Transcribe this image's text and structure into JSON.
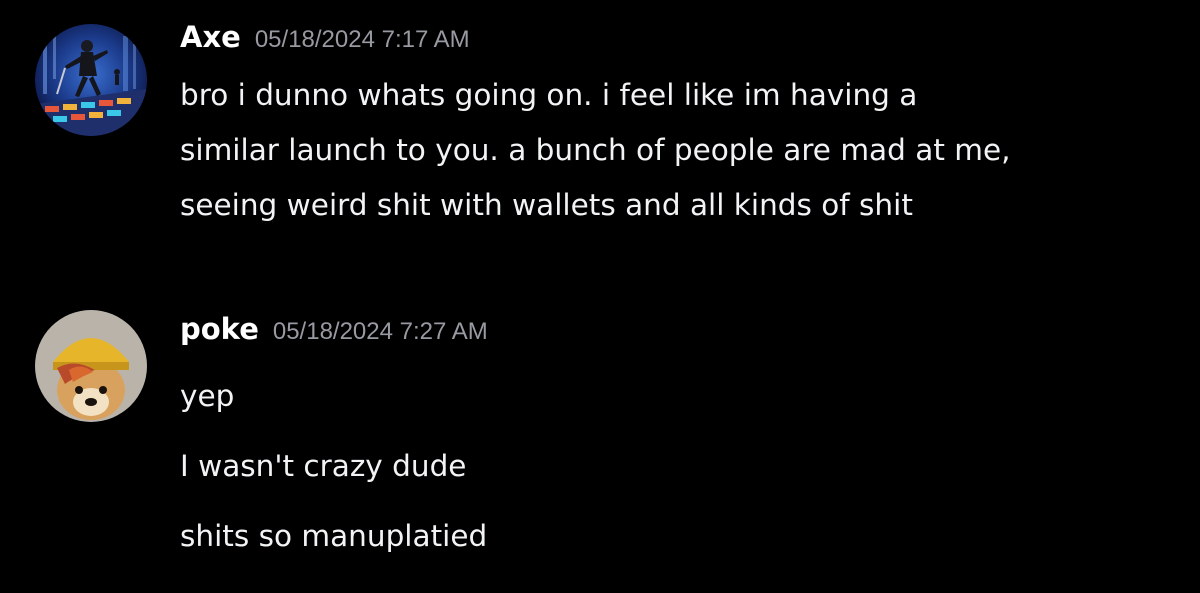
{
  "messages": [
    {
      "username": "Axe",
      "timestamp": "05/18/2024 7:17 AM",
      "lines": [
        "bro i dunno whats going on. i feel like im having a",
        "similar launch to you. a bunch of people are mad at me,",
        "seeing weird shit with wallets and all kinds of shit"
      ]
    },
    {
      "username": "poke",
      "timestamp": "05/18/2024 7:27 AM",
      "lines": [
        "yep",
        "I wasn't crazy dude",
        "shits so manuplatied"
      ]
    }
  ],
  "colors": {
    "background": "#000000",
    "username": "#ffffff",
    "timestamp": "#989aa2",
    "message_text": "#f2f3f5"
  }
}
